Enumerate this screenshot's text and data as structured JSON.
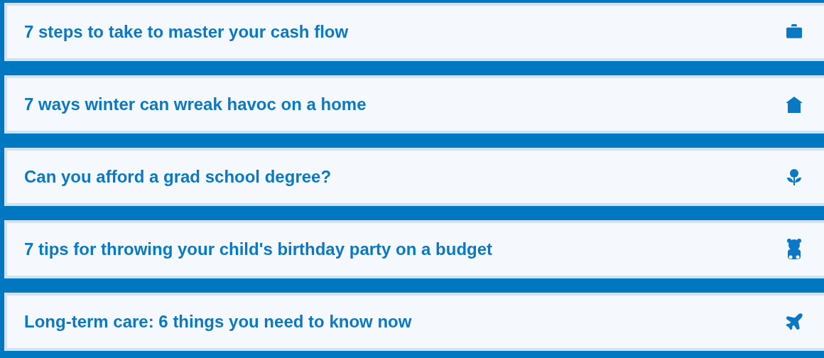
{
  "articles": [
    {
      "title": "7 steps to take to master your cash flow",
      "kind": "briefcase"
    },
    {
      "title": "7 ways winter can wreak havoc on a home",
      "kind": "house"
    },
    {
      "title": "Can you afford a grad school degree?",
      "kind": "plant"
    },
    {
      "title": "7 tips for throwing your child's birthday party on a budget",
      "kind": "bear"
    },
    {
      "title": "Long-term care: 6 things you need to know now",
      "kind": "plane"
    }
  ]
}
